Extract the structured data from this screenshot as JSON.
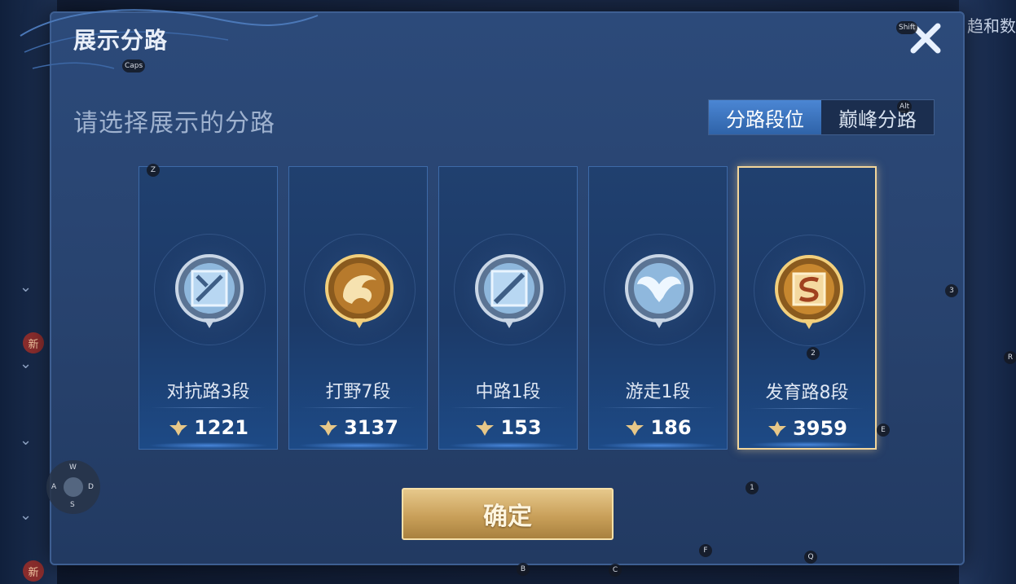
{
  "dialog": {
    "title": "展示分路",
    "subtitle": "请选择展示的分路",
    "tabs": [
      {
        "label": "分路段位",
        "active": true
      },
      {
        "label": "巅峰分路",
        "active": false
      }
    ],
    "cards": [
      {
        "rank": "对抗路3段",
        "score": "1221",
        "emblem": "clash-lane-emblem-icon",
        "tier": "silver",
        "selected": false
      },
      {
        "rank": "打野7段",
        "score": "3137",
        "emblem": "jungle-dragon-emblem-icon",
        "tier": "gold",
        "selected": false
      },
      {
        "rank": "中路1段",
        "score": "153",
        "emblem": "mid-lane-emblem-icon",
        "tier": "silver",
        "selected": false
      },
      {
        "rank": "游走1段",
        "score": "186",
        "emblem": "roam-wings-emblem-icon",
        "tier": "silver",
        "selected": false
      },
      {
        "rank": "发育路8段",
        "score": "3959",
        "emblem": "farm-lane-emblem-icon",
        "tier": "gold",
        "selected": true
      }
    ],
    "confirm_label": "确定"
  },
  "background": {
    "right_text": "趋和数",
    "side_badge": "新"
  },
  "key_hints": {
    "shift": "Shift",
    "caps": "Caps",
    "alt": "Alt",
    "z": "Z",
    "three": "3",
    "two": "2",
    "r": "R",
    "e": "E",
    "one": "1",
    "f": "F",
    "b": "B",
    "c": "C",
    "q": "Q",
    "w": "W",
    "a": "A",
    "s": "S",
    "d": "D"
  },
  "colors": {
    "accent_gold": "#f2d59a",
    "tab_active": "#3a74c2"
  }
}
